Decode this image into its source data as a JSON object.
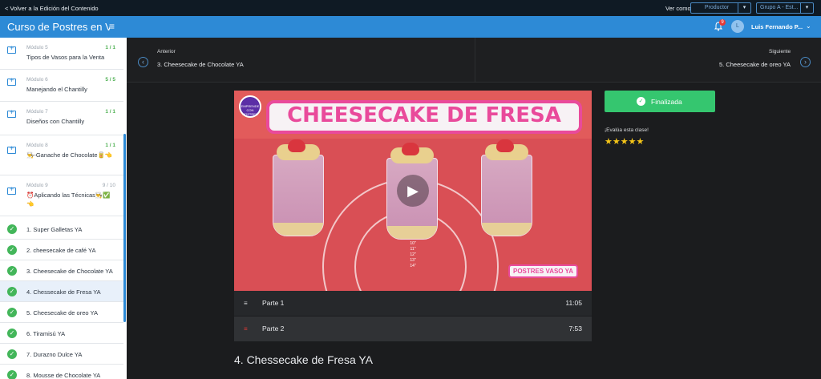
{
  "topbar": {
    "back_label": "< Volver a la Edición del Contenido",
    "ver_como_label": "Ver como",
    "role_select": "Productor",
    "group_select": "Grupo A - Est..."
  },
  "header": {
    "course_title": "Curso de Postres en Vaso",
    "menu_icon": "≡",
    "notification_count": "9",
    "avatar_initial": "L",
    "user_name": "Luis Fernando P...",
    "user_caret": "⌄"
  },
  "sidebar": {
    "modules": [
      {
        "name": "Módulo 5",
        "title": "Tipos de Vasos para la Venta",
        "count": "1 / 1",
        "complete": true
      },
      {
        "name": "Módulo 6",
        "title": "Manejando el Chantilly",
        "count": "5 / 5",
        "complete": true
      },
      {
        "name": "Módulo 7",
        "title": "Diseños con Chantilly",
        "count": "1 / 1",
        "complete": true
      },
      {
        "name": "Módulo 8",
        "title": "👨‍🍳-Ganache de Chocolate🥫👈",
        "count": "1 / 1",
        "complete": true
      },
      {
        "name": "Módulo 9",
        "title": "⏰Aplicando las Técnicas👨‍🍳✅👈",
        "count": "9 / 10",
        "complete": false
      }
    ],
    "lessons": [
      {
        "label": "1. Super Galletas YA",
        "active": false
      },
      {
        "label": "2. cheesecake de café YA",
        "active": false
      },
      {
        "label": "3. Cheesecake de Chocolate YA",
        "active": false
      },
      {
        "label": "4. Chessecake de Fresa YA",
        "active": true
      },
      {
        "label": "5. Cheesecake de oreo YA",
        "active": false
      },
      {
        "label": "6. Tiramisú YA",
        "active": false
      },
      {
        "label": "7. Durazno Dulce YA",
        "active": false
      },
      {
        "label": "8. Mousse de Chocolate YA",
        "active": false
      }
    ]
  },
  "nav": {
    "prev_label": "Anterior",
    "prev_title": "3. Cheesecake de Chocolate YA",
    "next_label": "Siguiente",
    "next_title": "5. Cheesecake de oreo YA"
  },
  "video": {
    "banner_text": "CHEESECAKE DE FRESA",
    "logo_text": "EMPRENDE CON POSTRES",
    "tag_text": "POSTRES VASO YA",
    "ruler_marks": [
      "10\"",
      "11\"",
      "12\"",
      "13\"",
      "14\""
    ]
  },
  "parts": [
    {
      "label": "Parte 1",
      "duration": "11:05"
    },
    {
      "label": "Parte 2",
      "duration": "7:53"
    }
  ],
  "actions": {
    "finalize_label": "Finalizada",
    "rate_prompt": "¡Evalúa esta clase!",
    "stars": "★★★★★",
    "star_rating": 5
  },
  "lesson_title": "4. Chessecake de Fresa YA",
  "colors": {
    "brand_blue": "#2d8ad6",
    "success_green": "#35c66f",
    "video_pink": "#e94a9b"
  }
}
